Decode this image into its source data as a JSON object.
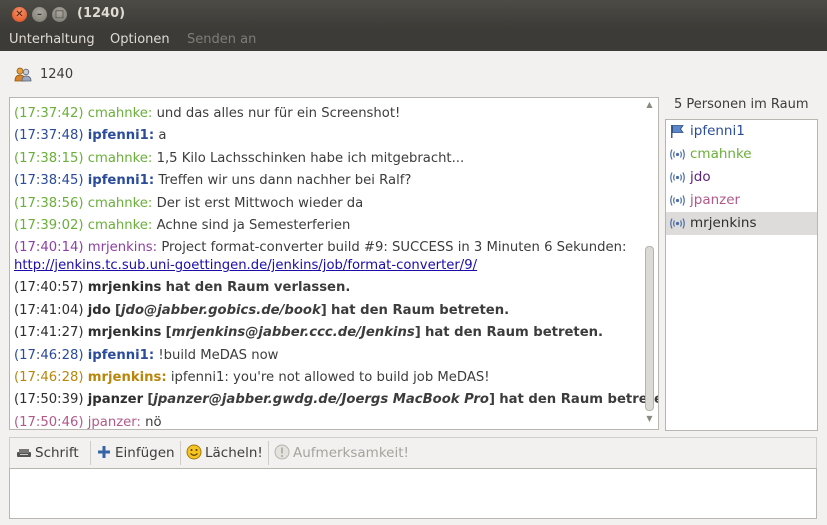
{
  "window": {
    "title": "(1240)"
  },
  "menu": [
    {
      "label": "Unterhaltung",
      "enabled": true
    },
    {
      "label": "Optionen",
      "enabled": true
    },
    {
      "label": "Senden an",
      "enabled": false
    }
  ],
  "room": {
    "name": "1240"
  },
  "chat": [
    {
      "ts": "(17:37:42)",
      "nick": "cmahnke:",
      "color": "green",
      "text": "und das alles nur für ein Screenshot!"
    },
    {
      "ts": "(17:37:48)",
      "nick": "ipfenni1:",
      "color": "blue",
      "text": "a"
    },
    {
      "ts": "(17:38:15)",
      "nick": "cmahnke:",
      "color": "green",
      "text": "1,5 Kilo Lachsschinken habe ich mitgebracht..."
    },
    {
      "ts": "(17:38:45)",
      "nick": "ipfenni1:",
      "color": "blue",
      "text": "Treffen wir uns dann nachher bei Ralf?"
    },
    {
      "ts": "(17:38:56)",
      "nick": "cmahnke:",
      "color": "green",
      "text": "Der ist erst Mittwoch wieder da"
    },
    {
      "ts": "(17:39:02)",
      "nick": "cmahnke:",
      "color": "green",
      "text": "Achne sind ja Semesterferien"
    },
    {
      "ts": "(17:40:14)",
      "nick": "mrjenkins:",
      "color": "purple",
      "text": "Project format-converter build #9: SUCCESS in 3 Minuten 6 Sekunden:",
      "link": "http://jenkins.tc.sub.uni-goettingen.de/jenkins/job/format-converter/9/"
    },
    {
      "ts": "(17:40:57)",
      "nick": "mrjenkins",
      "color": "system",
      "text": "hat den Raum verlassen."
    },
    {
      "ts": "(17:41:04)",
      "nick": "jdo",
      "color": "system",
      "jid": "jdo@jabber.gobics.de/book",
      "text": "hat den Raum betreten."
    },
    {
      "ts": "(17:41:27)",
      "nick": "mrjenkins",
      "color": "system",
      "jid": "mrjenkins@jabber.ccc.de/Jenkins",
      "text": "hat den Raum betreten."
    },
    {
      "ts": "(17:46:28)",
      "nick": "ipfenni1:",
      "color": "blue",
      "text": "!build MeDAS now"
    },
    {
      "ts": "(17:46:28)",
      "nick": "mrjenkins:",
      "color": "gold",
      "text": "ipfenni1: you're not allowed to build job MeDAS!"
    },
    {
      "ts": "(17:50:39)",
      "nick": "jpanzer",
      "color": "system",
      "jid": "jpanzer@jabber.gwdg.de/Joergs MacBook Pro",
      "text": "hat den Raum betreten."
    },
    {
      "ts": "(17:50:46)",
      "nick": "jpanzer:",
      "color": "pink",
      "text": "nö"
    }
  ],
  "roster": {
    "title": "5 Personen im Raum",
    "members": [
      {
        "name": "ipfenni1",
        "color": "#2b4b9b",
        "icon": "flag-icon",
        "selected": false
      },
      {
        "name": "cmahnke",
        "color": "#6aaf3b",
        "icon": "broadcast-icon",
        "selected": false
      },
      {
        "name": "jdo",
        "color": "#5a1f7a",
        "icon": "broadcast-icon",
        "selected": false
      },
      {
        "name": "jpanzer",
        "color": "#b15a8a",
        "icon": "broadcast-icon",
        "selected": false
      },
      {
        "name": "mrjenkins",
        "color": "#2e2e2e",
        "icon": "broadcast-icon",
        "selected": true
      }
    ]
  },
  "toolbar": {
    "font_label": "Schrift",
    "insert_label": "Einfügen",
    "smile_label": "Lächeln!",
    "attention_label": "Aufmerksamkeit!"
  }
}
